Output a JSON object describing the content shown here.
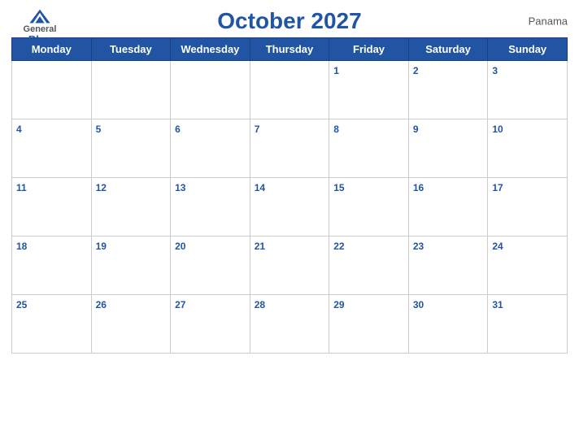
{
  "header": {
    "title": "October 2027",
    "country": "Panama",
    "logo": {
      "general": "General",
      "blue": "Blue"
    }
  },
  "days_of_week": [
    "Monday",
    "Tuesday",
    "Wednesday",
    "Thursday",
    "Friday",
    "Saturday",
    "Sunday"
  ],
  "weeks": [
    [
      null,
      null,
      null,
      null,
      1,
      2,
      3
    ],
    [
      4,
      5,
      6,
      7,
      8,
      9,
      10
    ],
    [
      11,
      12,
      13,
      14,
      15,
      16,
      17
    ],
    [
      18,
      19,
      20,
      21,
      22,
      23,
      24
    ],
    [
      25,
      26,
      27,
      28,
      29,
      30,
      31
    ]
  ],
  "colors": {
    "header_bg": "#2155a3",
    "accent": "#2155a3"
  }
}
